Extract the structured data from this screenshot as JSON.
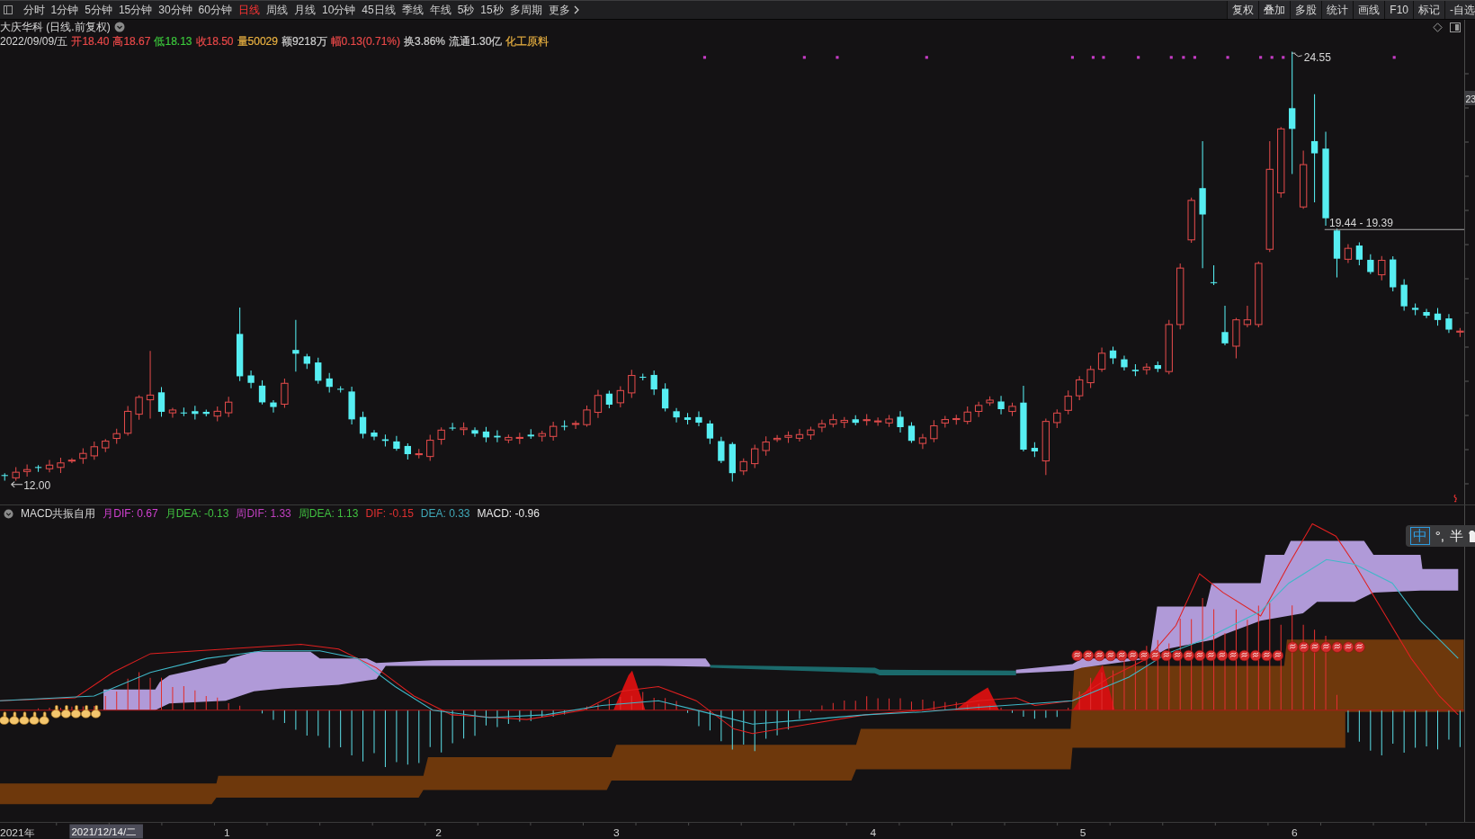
{
  "toolbar": {
    "periods": [
      {
        "label": "分时",
        "selected": false
      },
      {
        "label": "1分钟",
        "selected": false
      },
      {
        "label": "5分钟",
        "selected": false
      },
      {
        "label": "15分钟",
        "selected": false
      },
      {
        "label": "30分钟",
        "selected": false
      },
      {
        "label": "60分钟",
        "selected": false
      },
      {
        "label": "日线",
        "selected": true
      },
      {
        "label": "周线",
        "selected": false
      },
      {
        "label": "月线",
        "selected": false
      },
      {
        "label": "10分钟",
        "selected": false
      },
      {
        "label": "45日线",
        "selected": false
      },
      {
        "label": "季线",
        "selected": false
      },
      {
        "label": "年线",
        "selected": false
      },
      {
        "label": "5秒",
        "selected": false
      },
      {
        "label": "15秒",
        "selected": false
      },
      {
        "label": "多周期",
        "selected": false
      }
    ],
    "more": "更多",
    "tools": [
      "复权",
      "叠加",
      "多股",
      "统计",
      "画线",
      "F10",
      "标记",
      "-自选"
    ]
  },
  "stock_header": {
    "title": "大庆华科 (日线.前复权)",
    "date": "2022/09/09/五",
    "quotes": [
      {
        "text": "开18.40",
        "color": "#e84848"
      },
      {
        "text": "高18.67",
        "color": "#e84848"
      },
      {
        "text": "低18.13",
        "color": "#3cc83c"
      },
      {
        "text": "收18.50",
        "color": "#e84848"
      },
      {
        "text": "量50029",
        "color": "#e8b040"
      },
      {
        "text": "额9218万",
        "color": "#d0d0d0"
      },
      {
        "text": "幅0.13(0.71%)",
        "color": "#e84848"
      },
      {
        "text": "换3.86%",
        "color": "#d0d0d0"
      },
      {
        "text": "流通1.30亿",
        "color": "#d0d0d0"
      },
      {
        "text": "化工原料",
        "color": "#e8b040"
      }
    ]
  },
  "main_chart": {
    "high_label": "24.55",
    "low_label": "12.00",
    "range_label": "19.44 - 19.39",
    "axis_label": "23"
  },
  "indicator": {
    "name": "MACD共振自用",
    "values": [
      {
        "text": "月DIF: 0.67",
        "color": "#d040d0"
      },
      {
        "text": "月DEA: -0.13",
        "color": "#40c040"
      },
      {
        "text": "周DIF: 1.33",
        "color": "#c040c0"
      },
      {
        "text": "周DEA: 1.13",
        "color": "#40c040"
      },
      {
        "text": "DIF: -0.15",
        "color": "#e03030"
      },
      {
        "text": "DEA: 0.33",
        "color": "#40a8b8"
      },
      {
        "text": "MACD: -0.96",
        "color": "#e8e8e8"
      }
    ]
  },
  "ime": {
    "language": "中",
    "punctuation": "°,",
    "width": "半"
  },
  "x_axis": {
    "year": "2021年",
    "cursor_date": "2021/12/14/二",
    "months": [
      "1",
      "2",
      "3",
      "4",
      "5",
      "6"
    ]
  }
}
